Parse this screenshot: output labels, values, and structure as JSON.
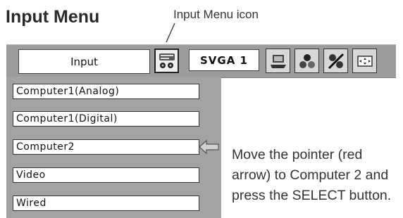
{
  "heading": "Input Menu",
  "icon_caption": "Input Menu icon",
  "menu_bar": {
    "current_input": "Input",
    "signal": "SVGA 1",
    "icons": [
      "input-menu-icon",
      "pc-adjust-icon",
      "image-select-icon",
      "image-adjust-icon",
      "screen-icon"
    ]
  },
  "input_list": [
    "Computer1(Analog)",
    "Computer1(Digital)",
    "Computer2",
    "Video",
    "Wired"
  ],
  "pointer": {
    "target": "Computer2",
    "color": "#c8c8c8"
  },
  "instruction": "Move the pointer (red arrow) to Computer 2 and press the SELECT button."
}
